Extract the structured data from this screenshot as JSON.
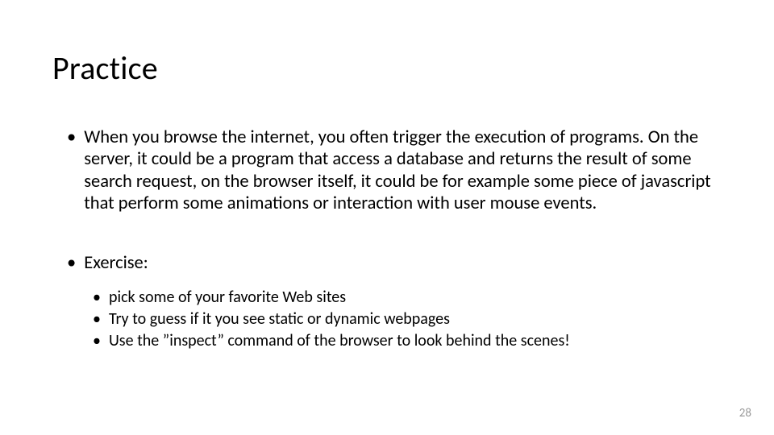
{
  "slide": {
    "title": "Practice",
    "bullets": [
      {
        "text": "When you browse the internet, you often trigger the execution of programs. On the server, it could be a program that access a database and returns the result of some search request, on the browser itself, it could be for example  some piece of javascript that perform some animations or interaction with user mouse events."
      },
      {
        "text": "Exercise:",
        "sub": [
          "pick some of your favorite Web sites",
          "Try to guess if it you see static or dynamic webpages",
          "Use the ”inspect” command of the browser to look behind the scenes!"
        ]
      }
    ],
    "page_number": "28"
  }
}
